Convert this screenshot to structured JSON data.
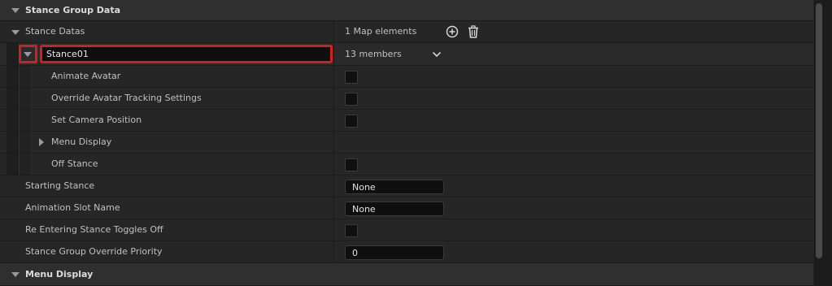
{
  "categories": {
    "stance_group_data": "Stance Group Data",
    "menu_display": "Menu Display"
  },
  "stance_datas": {
    "label": "Stance Datas",
    "count": "1 Map elements",
    "add_icon": "plus-circle-icon",
    "delete_icon": "trash-icon"
  },
  "map_entry": {
    "key_value": "Stance01",
    "members": "13 members",
    "dropdown_icon": "chevron-down-icon",
    "highlight_color": "#d02020"
  },
  "entry_props": [
    {
      "label": "Animate Avatar"
    },
    {
      "label": "Override Avatar Tracking Settings"
    },
    {
      "label": "Set Camera Position"
    },
    {
      "label": "Menu Display"
    },
    {
      "label": "Off Stance"
    }
  ],
  "props": {
    "starting_stance": {
      "label": "Starting Stance",
      "value": "None"
    },
    "animation_slot_name": {
      "label": "Animation Slot Name",
      "value": "None"
    },
    "re_entering": {
      "label": "Re Entering Stance Toggles Off"
    },
    "override_priority": {
      "label": "Stance Group Override Priority",
      "value": "0"
    }
  }
}
